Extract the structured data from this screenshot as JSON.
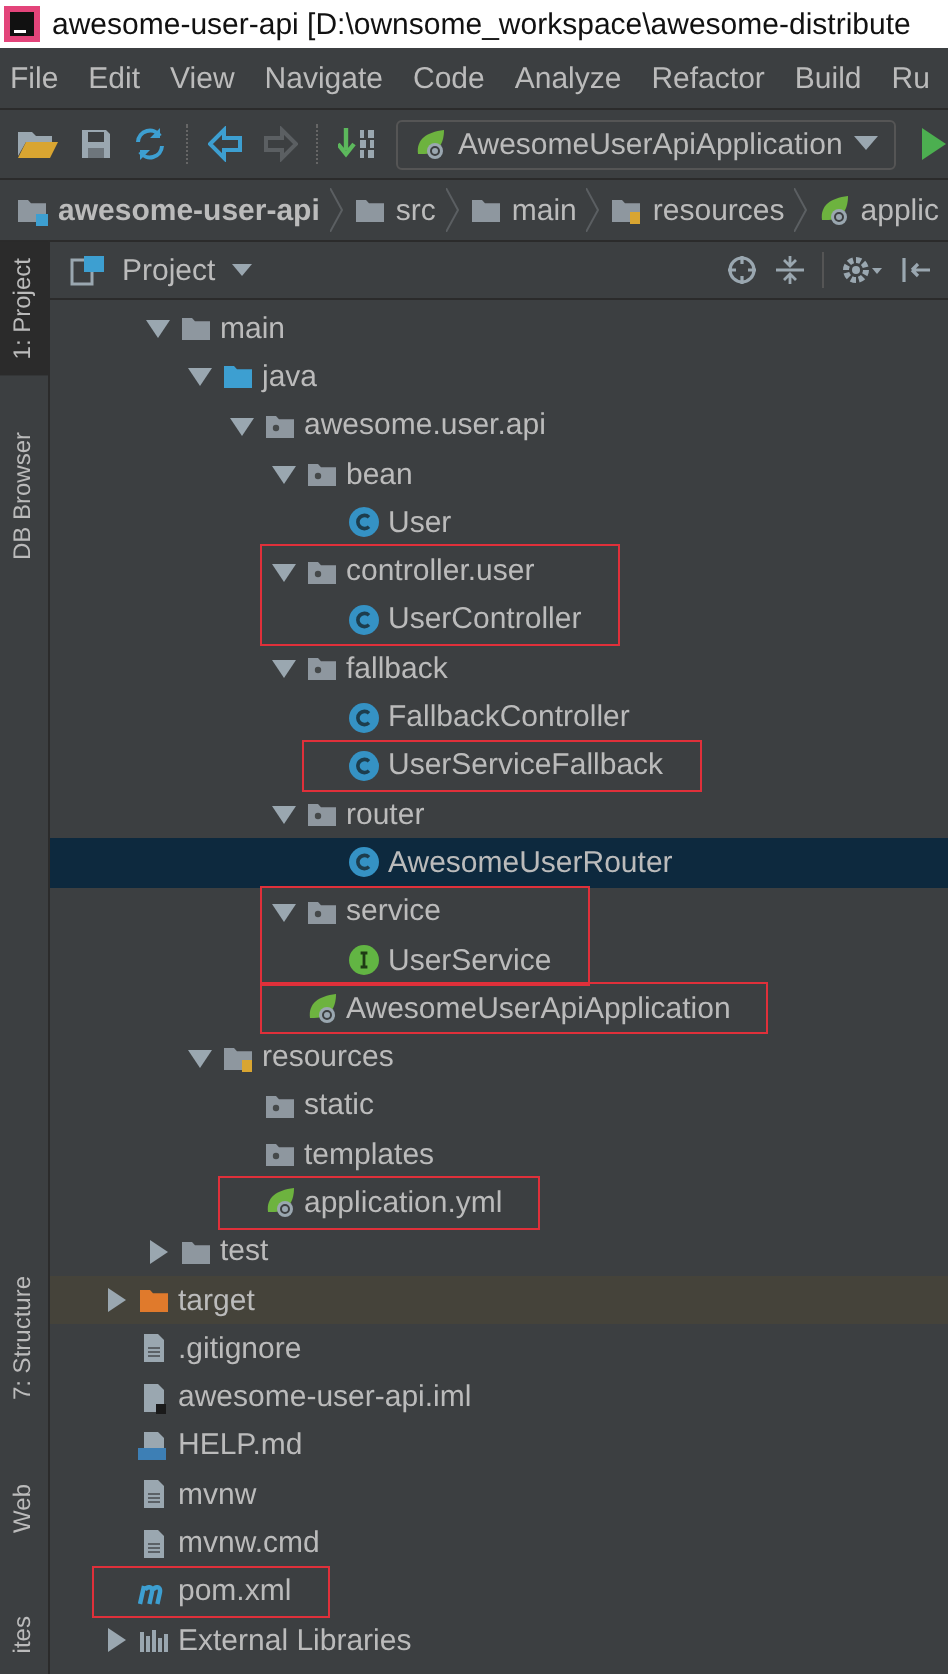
{
  "window": {
    "title": "awesome-user-api [D:\\ownsome_workspace\\awesome-distribute"
  },
  "menu": [
    "File",
    "Edit",
    "View",
    "Navigate",
    "Code",
    "Analyze",
    "Refactor",
    "Build",
    "Ru"
  ],
  "toolbar": {
    "run_config": "AwesomeUserApiApplication"
  },
  "breadcrumbs": [
    {
      "label": "awesome-user-api",
      "kind": "module"
    },
    {
      "label": "src",
      "kind": "folder"
    },
    {
      "label": "main",
      "kind": "folder"
    },
    {
      "label": "resources",
      "kind": "resource-folder"
    },
    {
      "label": "applic",
      "kind": "spring-config"
    }
  ],
  "side_tabs_top": [
    {
      "label": "1: Project",
      "selected": true
    },
    {
      "label": "DB Browser",
      "selected": false
    }
  ],
  "side_tabs_bottom": [
    {
      "label": "7: Structure",
      "selected": false
    },
    {
      "label": "Web",
      "selected": false
    },
    {
      "label": "ites",
      "selected": false
    }
  ],
  "project_panel": {
    "title": "Project"
  },
  "tree": {
    "src_children": [
      {
        "label": "main",
        "kind": "folder",
        "selected": false,
        "boxed": false,
        "expanded": true,
        "children": [
          {
            "label": "java",
            "kind": "source-folder",
            "selected": false,
            "boxed": false,
            "expanded": true,
            "children": [
              {
                "label": "awesome.user.api",
                "kind": "package",
                "selected": false,
                "boxed": false,
                "expanded": true,
                "children": [
                  {
                    "label": "bean",
                    "kind": "package",
                    "selected": false,
                    "boxed": false,
                    "expanded": true,
                    "children": [
                      {
                        "label": "User",
                        "kind": "class",
                        "selected": false,
                        "boxed": false
                      }
                    ]
                  },
                  {
                    "label": "controller.user",
                    "kind": "package",
                    "selected": false,
                    "boxed": true,
                    "expanded": true,
                    "children": [
                      {
                        "label": "UserController",
                        "kind": "class",
                        "selected": false,
                        "boxed": false
                      }
                    ]
                  },
                  {
                    "label": "fallback",
                    "kind": "package",
                    "selected": false,
                    "boxed": false,
                    "expanded": true,
                    "children": [
                      {
                        "label": "FallbackController",
                        "kind": "class",
                        "selected": false,
                        "boxed": false
                      },
                      {
                        "label": "UserServiceFallback",
                        "kind": "class",
                        "selected": false,
                        "boxed": true
                      }
                    ]
                  },
                  {
                    "label": "router",
                    "kind": "package",
                    "selected": false,
                    "boxed": false,
                    "expanded": true,
                    "children": [
                      {
                        "label": "AwesomeUserRouter",
                        "kind": "class",
                        "selected": true,
                        "boxed": false
                      }
                    ]
                  },
                  {
                    "label": "service",
                    "kind": "package",
                    "selected": false,
                    "boxed": true,
                    "expanded": true,
                    "children": [
                      {
                        "label": "UserService",
                        "kind": "interface",
                        "selected": false,
                        "boxed": false
                      }
                    ]
                  },
                  {
                    "label": "AwesomeUserApiApplication",
                    "kind": "spring-boot-app",
                    "selected": false,
                    "boxed": true
                  }
                ]
              }
            ]
          },
          {
            "label": "resources",
            "kind": "resource-folder",
            "selected": false,
            "boxed": false,
            "expanded": true,
            "children": [
              {
                "label": "static",
                "kind": "package",
                "selected": false,
                "boxed": false
              },
              {
                "label": "templates",
                "kind": "package",
                "selected": false,
                "boxed": false
              },
              {
                "label": "application.yml",
                "kind": "spring-config",
                "selected": false,
                "boxed": true
              }
            ]
          }
        ]
      },
      {
        "label": "test",
        "kind": "folder",
        "selected": false,
        "boxed": false,
        "expanded": false
      }
    ],
    "root_items": [
      {
        "label": "target",
        "kind": "excluded-folder",
        "selected": false,
        "boxed": false,
        "expanded": false
      },
      {
        "label": ".gitignore",
        "kind": "file",
        "selected": false,
        "boxed": false
      },
      {
        "label": "awesome-user-api.iml",
        "kind": "module-file",
        "selected": false,
        "boxed": false
      },
      {
        "label": "HELP.md",
        "kind": "markdown",
        "selected": false,
        "boxed": false
      },
      {
        "label": "mvnw",
        "kind": "file",
        "selected": false,
        "boxed": false
      },
      {
        "label": "mvnw.cmd",
        "kind": "file",
        "selected": false,
        "boxed": false
      },
      {
        "label": "pom.xml",
        "kind": "maven",
        "selected": false,
        "boxed": true
      },
      {
        "label": "External Libraries",
        "kind": "library",
        "selected": false,
        "boxed": false,
        "expanded": false
      }
    ]
  }
}
